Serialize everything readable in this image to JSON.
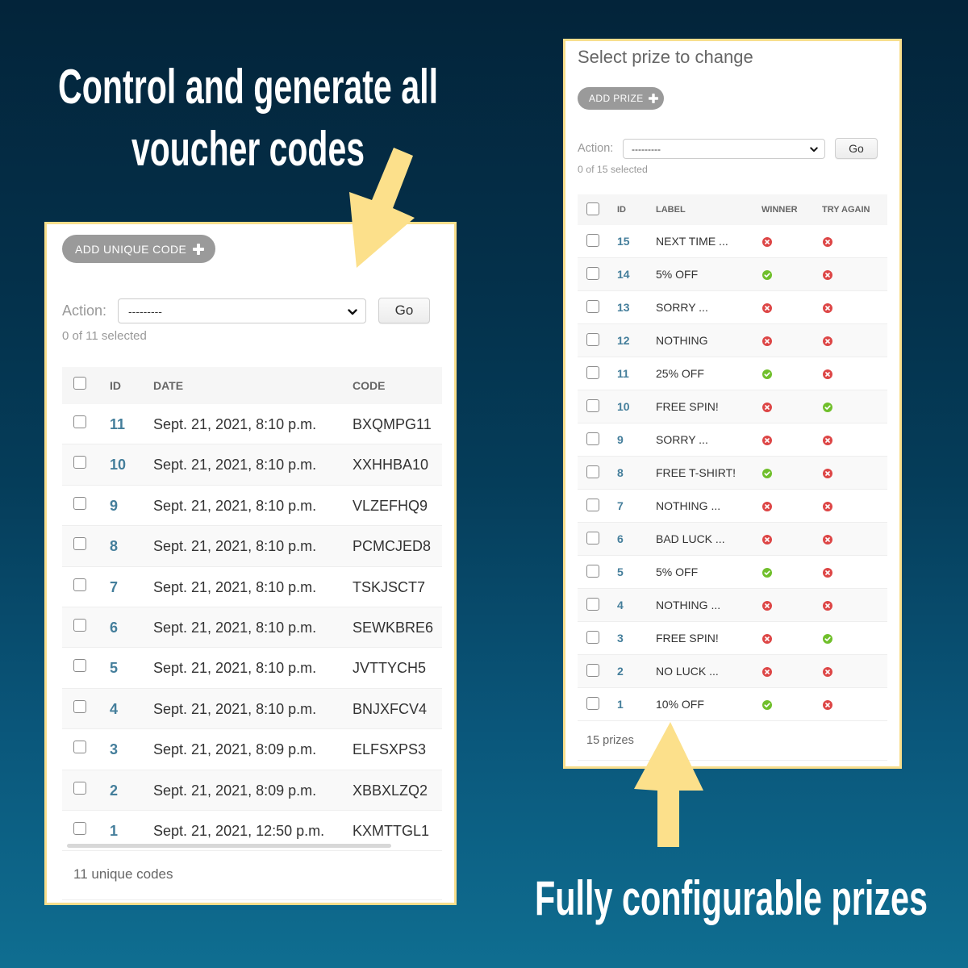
{
  "headlines": {
    "top_line_1": "Control and generate all",
    "top_line_2": "voucher codes",
    "bottom": "Fully configurable prizes"
  },
  "colors": {
    "highlight_yellow": "#fce08b",
    "link_blue": "#447e9b",
    "button_gray": "#9a9a9a",
    "yes_green": "#70bf2b",
    "no_red": "#dd4646"
  },
  "codes_panel": {
    "add_button": "ADD UNIQUE CODE",
    "action_label": "Action:",
    "action_selected": "---------",
    "go_label": "Go",
    "selection_count": "0 of 11 selected",
    "columns": {
      "id": "ID",
      "date": "DATE",
      "code": "CODE"
    },
    "rows": [
      {
        "id": "11",
        "date": "Sept. 21, 2021, 8:10 p.m.",
        "code": "BXQMPG11"
      },
      {
        "id": "10",
        "date": "Sept. 21, 2021, 8:10 p.m.",
        "code": "XXHHBA10"
      },
      {
        "id": "9",
        "date": "Sept. 21, 2021, 8:10 p.m.",
        "code": "VLZEFHQ9"
      },
      {
        "id": "8",
        "date": "Sept. 21, 2021, 8:10 p.m.",
        "code": "PCMCJED8"
      },
      {
        "id": "7",
        "date": "Sept. 21, 2021, 8:10 p.m.",
        "code": "TSKJSCT7"
      },
      {
        "id": "6",
        "date": "Sept. 21, 2021, 8:10 p.m.",
        "code": "SEWKBRE6"
      },
      {
        "id": "5",
        "date": "Sept. 21, 2021, 8:10 p.m.",
        "code": "JVTTYCH5"
      },
      {
        "id": "4",
        "date": "Sept. 21, 2021, 8:10 p.m.",
        "code": "BNJXFCV4"
      },
      {
        "id": "3",
        "date": "Sept. 21, 2021, 8:09 p.m.",
        "code": "ELFSXPS3"
      },
      {
        "id": "2",
        "date": "Sept. 21, 2021, 8:09 p.m.",
        "code": "XBBXLZQ2"
      },
      {
        "id": "1",
        "date": "Sept. 21, 2021, 12:50 p.m.",
        "code": "KXMTTGL1"
      }
    ],
    "footer": "11 unique codes"
  },
  "prizes_panel": {
    "title": "Select prize to change",
    "add_button": "ADD PRIZE",
    "action_label": "Action:",
    "action_selected": "---------",
    "go_label": "Go",
    "selection_count": "0 of 15 selected",
    "columns": {
      "id": "ID",
      "label": "LABEL",
      "winner": "WINNER",
      "try_again": "TRY AGAIN"
    },
    "rows": [
      {
        "id": "15",
        "label": "NEXT TIME ...",
        "winner": false,
        "try_again": false
      },
      {
        "id": "14",
        "label": "5% OFF",
        "winner": true,
        "try_again": false
      },
      {
        "id": "13",
        "label": "SORRY ...",
        "winner": false,
        "try_again": false
      },
      {
        "id": "12",
        "label": "NOTHING",
        "winner": false,
        "try_again": false
      },
      {
        "id": "11",
        "label": "25% OFF",
        "winner": true,
        "try_again": false
      },
      {
        "id": "10",
        "label": "FREE SPIN!",
        "winner": false,
        "try_again": true
      },
      {
        "id": "9",
        "label": "SORRY ...",
        "winner": false,
        "try_again": false
      },
      {
        "id": "8",
        "label": "FREE T-SHIRT!",
        "winner": true,
        "try_again": false
      },
      {
        "id": "7",
        "label": "NOTHING ...",
        "winner": false,
        "try_again": false
      },
      {
        "id": "6",
        "label": "BAD LUCK ...",
        "winner": false,
        "try_again": false
      },
      {
        "id": "5",
        "label": "5% OFF",
        "winner": true,
        "try_again": false
      },
      {
        "id": "4",
        "label": "NOTHING ...",
        "winner": false,
        "try_again": false
      },
      {
        "id": "3",
        "label": "FREE SPIN!",
        "winner": false,
        "try_again": true
      },
      {
        "id": "2",
        "label": "NO LUCK ...",
        "winner": false,
        "try_again": false
      },
      {
        "id": "1",
        "label": "10% OFF",
        "winner": true,
        "try_again": false
      }
    ],
    "footer": "15 prizes"
  }
}
